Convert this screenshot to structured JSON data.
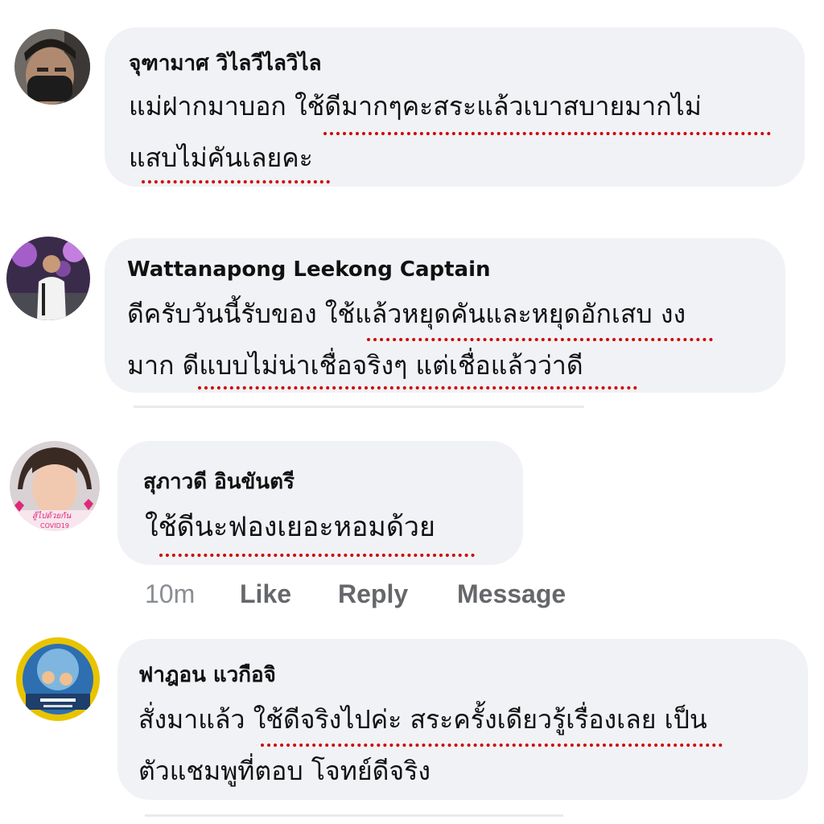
{
  "colors": {
    "bubble": "#f0f2f5",
    "text": "#111111",
    "underline": "#d00000",
    "action_muted": "#65676b",
    "action_time": "#8a8d91"
  },
  "comments": [
    {
      "author": "จุฑามาศ วิไลวีไลวิไล",
      "lines": [
        "แม่ฝากมาบอก ใช้ดีมากๆคะสระแล้วเบาสบายมากไม่",
        "แสบไม่คันเลยคะ"
      ]
    },
    {
      "author": "Wattanapong Leekong Captain",
      "lines": [
        "ดีครับวันนี้รับของ ใช้แล้วหยุดคันและหยุดอักเสบ งง",
        "มาก ดีแบบไม่น่าเชื่อจริงๆ แต่เชื่อแล้วว่าดี"
      ]
    },
    {
      "author": "สุภาวดี อินขันตรี",
      "lines": [
        "ใช้ดีนะฟองเยอะหอมด้วย"
      ],
      "avatar_text": "COVID19",
      "actions": {
        "time": "10m",
        "like": "Like",
        "reply": "Reply",
        "message": "Message"
      }
    },
    {
      "author": "ฟาฎอน แวกือจิ",
      "lines": [
        "สั่งมาแล้ว ใช้ดีจริงไปค่ะ สระครั้งเดียวรู้เรื่องเลย เป็น",
        "ตัวแชมพูที่ตอบ โจทย์ดีจริง"
      ]
    }
  ]
}
